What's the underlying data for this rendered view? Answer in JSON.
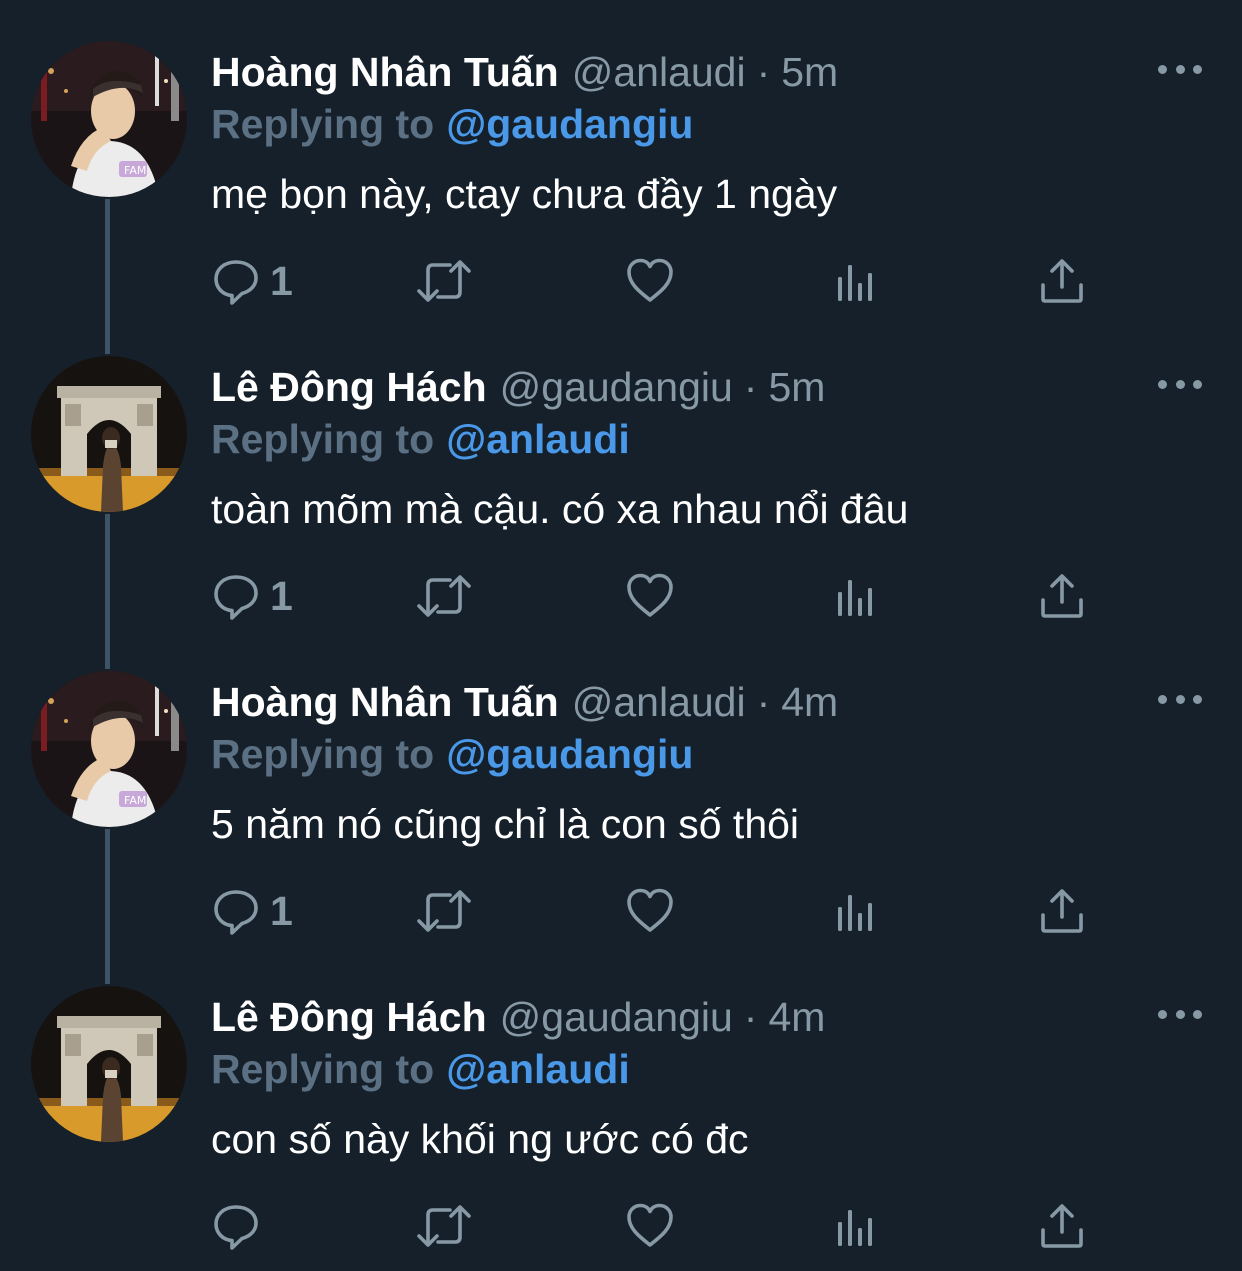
{
  "colors": {
    "background": "#15202b",
    "name": "#ffffff",
    "secondary": "#8899a6",
    "reply_prefix": "#5b7083",
    "mention": "#4a99e9",
    "thread_line": "#3d5466"
  },
  "tweets": [
    {
      "name": "Hoàng Nhân Tuấn",
      "handle": "@anlaudi",
      "separator": "·",
      "time": "5m",
      "reply_prefix": "Replying to",
      "reply_target": "@gaudangiu",
      "text": "mẹ bọn này, ctay chưa đầy 1 ngày",
      "reply_count": "1",
      "avatar_icon": "profile-photo-man-white-shirt"
    },
    {
      "name": "Lê Đông Hách",
      "handle": "@gaudangiu",
      "separator": "·",
      "time": "5m",
      "reply_prefix": "Replying to",
      "reply_target": "@anlaudi",
      "text": "toàn mõm mà cậu. có xa nhau nổi đâu",
      "reply_count": "1",
      "avatar_icon": "profile-photo-arc-de-triomphe"
    },
    {
      "name": "Hoàng Nhân Tuấn",
      "handle": "@anlaudi",
      "separator": "·",
      "time": "4m",
      "reply_prefix": "Replying to",
      "reply_target": "@gaudangiu",
      "text": "5 năm nó cũng chỉ là con số thôi",
      "reply_count": "1",
      "avatar_icon": "profile-photo-man-white-shirt"
    },
    {
      "name": "Lê Đông Hách",
      "handle": "@gaudangiu",
      "separator": "·",
      "time": "4m",
      "reply_prefix": "Replying to",
      "reply_target": "@anlaudi",
      "text": "con số này khối ng ước có đc",
      "reply_count": "",
      "avatar_icon": "profile-photo-arc-de-triomphe"
    }
  ],
  "action_icons": [
    "reply-icon",
    "retweet-icon",
    "like-icon",
    "analytics-icon",
    "share-icon"
  ],
  "more_icon": "more-options-icon"
}
